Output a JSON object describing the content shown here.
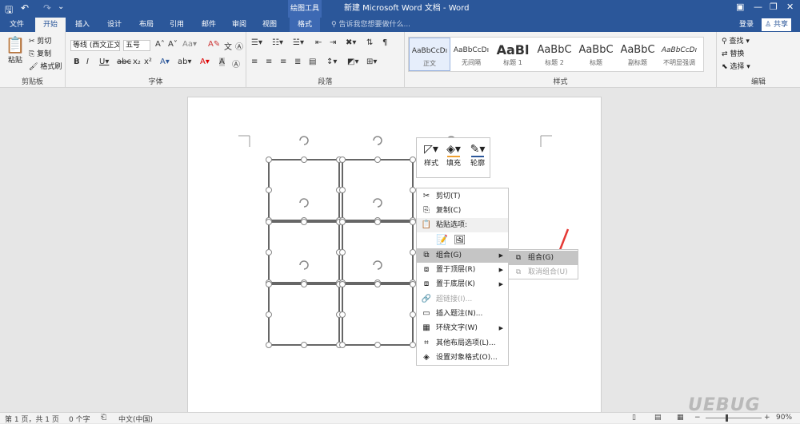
{
  "window": {
    "context_tab": "绘图工具",
    "title": "新建 Microsoft Word 文档 - Word"
  },
  "tabs": [
    "文件",
    "开始",
    "插入",
    "设计",
    "布局",
    "引用",
    "邮件",
    "审阅",
    "视图",
    "格式"
  ],
  "tell_me": "告诉我您想要做什么...",
  "login": "登录",
  "share": "共享",
  "clipboard": {
    "paste": "粘贴",
    "cut": "剪切",
    "copy": "复制",
    "format_painter": "格式刷",
    "label": "剪贴板"
  },
  "font": {
    "name": "等线 (西文正文)",
    "size": "五号",
    "label": "字体"
  },
  "paragraph": {
    "label": "段落"
  },
  "styles": {
    "label": "样式",
    "items": [
      {
        "preview": "AaBbCcDı",
        "name": "正文"
      },
      {
        "preview": "AaBbCcDı",
        "name": "无间隔"
      },
      {
        "preview": "AaBl",
        "name": "标题 1"
      },
      {
        "preview": "AaBbC",
        "name": "标题 2"
      },
      {
        "preview": "AaBbC",
        "name": "标题"
      },
      {
        "preview": "AaBbC",
        "name": "副标题"
      },
      {
        "preview": "AaBbCcDı",
        "name": "不明显强调"
      }
    ]
  },
  "editing": {
    "find": "查找",
    "replace": "替换",
    "select": "选择",
    "label": "编辑"
  },
  "mini_toolbar": {
    "style": "样式",
    "fill": "填充",
    "outline": "轮廓"
  },
  "context_menu": {
    "cut": "剪切(T)",
    "copy": "复制(C)",
    "paste_options": "粘贴选项:",
    "group": "组合(G)",
    "bring_front": "置于顶层(R)",
    "send_back": "置于底层(K)",
    "hyperlink": "超链接(I)...",
    "insert_caption": "插入题注(N)...",
    "wrap_text": "环绕文字(W)",
    "more_layout": "其他布局选项(L)...",
    "format_object": "设置对象格式(O)..."
  },
  "submenu": {
    "group": "组合(G)",
    "ungroup": "取消组合(U)"
  },
  "status": {
    "page": "第 1 页，共 1 页",
    "words": "0 个字",
    "language": "中文(中国)",
    "zoom": "90%"
  },
  "colors": {
    "accent": "#2b579a",
    "arrow": "#e53935"
  },
  "watermark": "UEBUG"
}
